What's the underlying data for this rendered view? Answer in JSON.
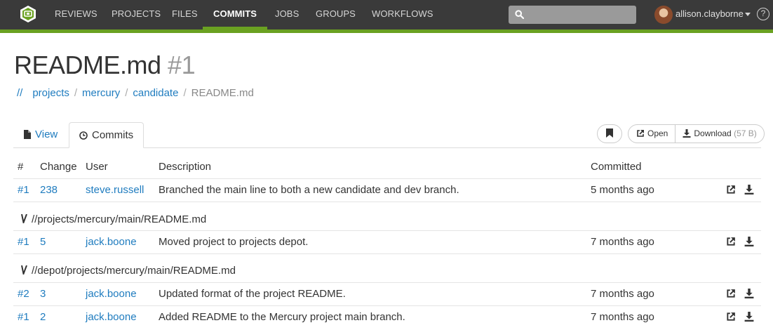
{
  "nav": {
    "items": [
      "REVIEWS",
      "PROJECTS",
      "FILES",
      "COMMITS",
      "JOBS",
      "GROUPS",
      "WORKFLOWS"
    ],
    "active": "COMMITS",
    "search_placeholder": "",
    "username": "allison.clayborne",
    "help_label": "?"
  },
  "page": {
    "title": "README.md",
    "title_number": "#1",
    "breadcrumb": {
      "root": "//",
      "parts": [
        "projects",
        "mercury",
        "candidate"
      ],
      "current": "README.md"
    }
  },
  "tabs": {
    "view": "View",
    "commits": "Commits"
  },
  "toolbar": {
    "open_label": "Open",
    "download_label": "Download",
    "download_size": "(57 B)"
  },
  "table": {
    "headers": [
      "#",
      "Change",
      "User",
      "Description",
      "Committed"
    ],
    "groups": [
      {
        "path": "",
        "rows": [
          {
            "rev": "#1",
            "change": "238",
            "user": "steve.russell",
            "description": "Branched the main line to both a new candidate and dev branch.",
            "committed": "5 months ago"
          }
        ]
      },
      {
        "path": "//projects/mercury/main/README.md",
        "rows": [
          {
            "rev": "#1",
            "change": "5",
            "user": "jack.boone",
            "description": "Moved project to projects depot.",
            "committed": "7 months ago"
          }
        ]
      },
      {
        "path": "//depot/projects/mercury/main/README.md",
        "rows": [
          {
            "rev": "#2",
            "change": "3",
            "user": "jack.boone",
            "description": "Updated format of the project README.",
            "committed": "7 months ago"
          },
          {
            "rev": "#1",
            "change": "2",
            "user": "jack.boone",
            "description": "Added README to the Mercury project main branch.",
            "committed": "7 months ago"
          }
        ]
      }
    ]
  },
  "colors": {
    "navbar": "#3a3a3a",
    "accent": "#6aa121",
    "link": "#1f7cbf"
  },
  "icons": [
    "swarm-logo-icon",
    "search-icon",
    "file-icon",
    "clock-icon",
    "bookmark-icon",
    "open-external-icon",
    "download-icon",
    "branch-icon",
    "help-icon",
    "caret-down-icon"
  ]
}
